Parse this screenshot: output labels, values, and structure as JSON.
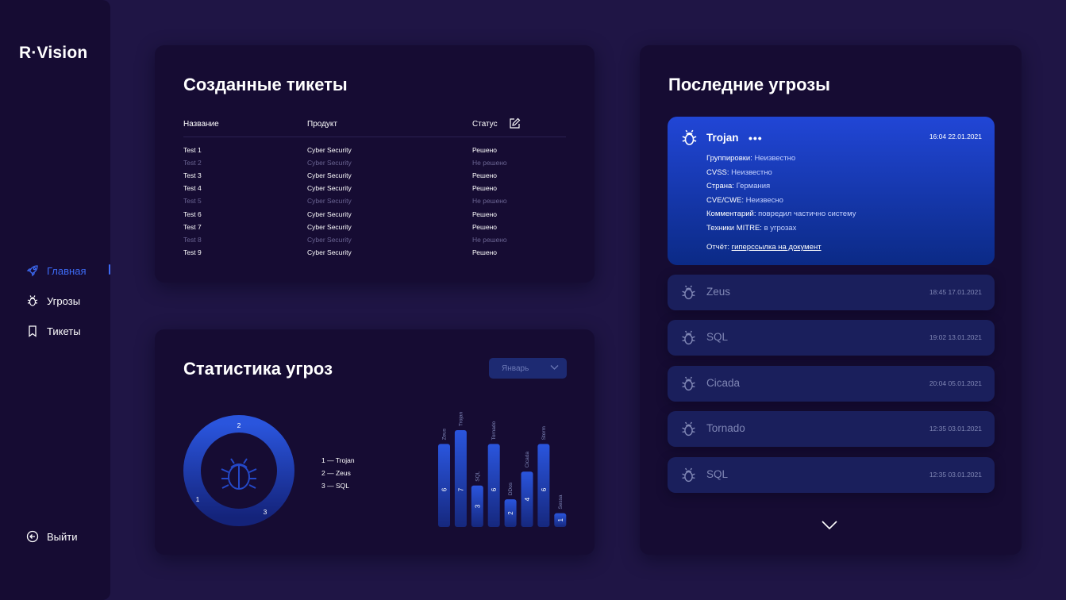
{
  "app": {
    "logo": "R·Vision"
  },
  "nav": {
    "home": "Главная",
    "threats": "Угрозы",
    "tickets": "Тикеты",
    "logout": "Выйти"
  },
  "tickets": {
    "title": "Созданные тикеты",
    "columns": {
      "name": "Название",
      "product": "Продукт",
      "status": "Статус"
    },
    "rows": [
      {
        "name": "Test 1",
        "product": "Cyber Security",
        "status": "Решено"
      },
      {
        "name": "Test 2",
        "product": "Cyber Security",
        "status": "Не решено"
      },
      {
        "name": "Test 3",
        "product": "Cyber Security",
        "status": "Решено"
      },
      {
        "name": "Test 4",
        "product": "Cyber Security",
        "status": "Решено"
      },
      {
        "name": "Test 5",
        "product": "Cyber Security",
        "status": "Не решено"
      },
      {
        "name": "Test 6",
        "product": "Cyber Security",
        "status": "Решено"
      },
      {
        "name": "Test 7",
        "product": "Cyber Security",
        "status": "Решено"
      },
      {
        "name": "Test 8",
        "product": "Cyber Security",
        "status": "Не решено"
      },
      {
        "name": "Test 9",
        "product": "Cyber Security",
        "status": "Решено"
      }
    ]
  },
  "stats": {
    "title": "Статистика угроз",
    "month": "Январь",
    "legend": [
      "1 — Trojan",
      "2 — Zeus",
      "3 — SQL"
    ],
    "donut_labels": [
      "1",
      "2",
      "3"
    ]
  },
  "chart_data": {
    "type": "bar",
    "categories": [
      "Zeus",
      "Trojan",
      "SQL",
      "Tornado",
      "DDos",
      "Cicada",
      "Storm",
      "Sessa"
    ],
    "values": [
      6,
      7,
      3,
      6,
      2,
      4,
      6,
      1
    ],
    "ylim": [
      0,
      7
    ]
  },
  "threats": {
    "title": "Последние угрозы",
    "open": {
      "name": "Trojan",
      "time": "16:04 22.01.2021",
      "details": [
        {
          "label": "Группировки:",
          "value": "Неизвестно"
        },
        {
          "label": "CVSS:",
          "value": "Неизвестно"
        },
        {
          "label": "Страна:",
          "value": "Германия"
        },
        {
          "label": "CVE/CWE:",
          "value": "Неизвесно"
        },
        {
          "label": "Комментарий:",
          "value": "повредил частично систему"
        },
        {
          "label": "Техники MITRE:",
          "value": "в угрозах"
        }
      ],
      "report_label": "Отчёт:",
      "report_link": "гиперссылка на документ"
    },
    "items": [
      {
        "name": "Zeus",
        "time": "18:45 17.01.2021"
      },
      {
        "name": "SQL",
        "time": "19:02 13.01.2021"
      },
      {
        "name": "Cicada",
        "time": "20:04 05.01.2021"
      },
      {
        "name": "Tornado",
        "time": "12:35 03.01.2021"
      },
      {
        "name": "SQL",
        "time": "12:35 03.01.2021"
      }
    ]
  },
  "colors": {
    "accent": "#3d6bf5",
    "card": "#160c33",
    "background": "#1f1545"
  }
}
